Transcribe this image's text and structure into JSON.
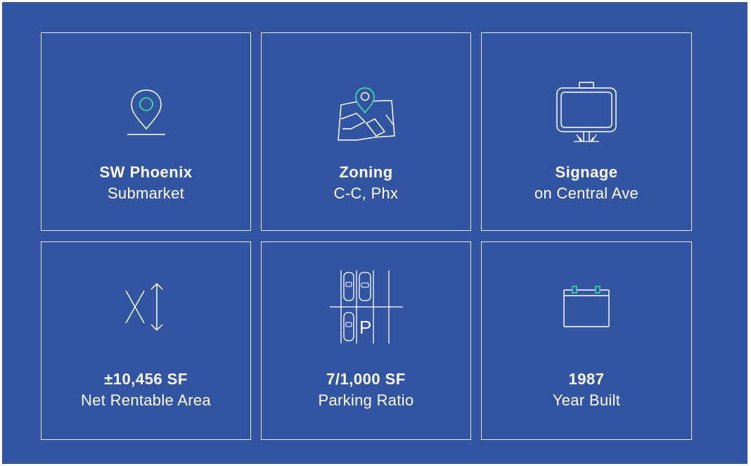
{
  "colors": {
    "background": "#3355a1",
    "line": "#ffffff",
    "accent": "#3ed8a4"
  },
  "cards": [
    {
      "icon": "location-pin-icon",
      "title": "SW Phoenix",
      "subtitle": "Submarket"
    },
    {
      "icon": "map-pin-icon",
      "title": "Zoning",
      "subtitle": "C-C, Phx"
    },
    {
      "icon": "signboard-icon",
      "title": "Signage",
      "subtitle": "on Central Ave"
    },
    {
      "icon": "area-dimension-icon",
      "title": "±10,456 SF",
      "subtitle": "Net Rentable Area"
    },
    {
      "icon": "parking-icon",
      "title": "7/1,000 SF",
      "subtitle": "Parking Ratio",
      "icon_text": "P"
    },
    {
      "icon": "calendar-icon",
      "title": "1987",
      "subtitle": "Year Built"
    }
  ]
}
